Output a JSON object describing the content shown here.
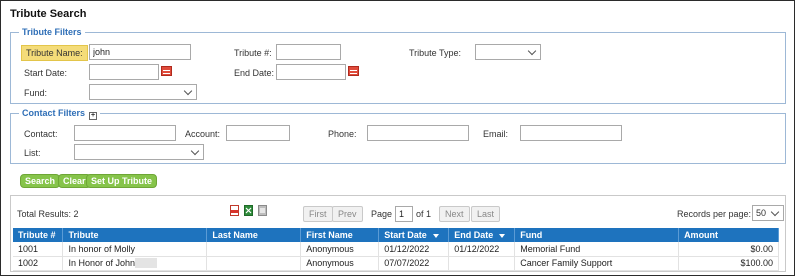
{
  "title": "Tribute Search",
  "tribute_filters": {
    "legend": "Tribute Filters",
    "name_label": "Tribute Name:",
    "name_value": "john",
    "number_label": "Tribute #:",
    "number_value": "",
    "type_label": "Tribute Type:",
    "type_value": "",
    "start_label": "Start Date:",
    "start_value": "",
    "end_label": "End Date:",
    "end_value": "",
    "fund_label": "Fund:",
    "fund_value": ""
  },
  "contact_filters": {
    "legend": "Contact Filters",
    "toggle": "+",
    "contact_label": "Contact:",
    "account_label": "Account:",
    "phone_label": "Phone:",
    "email_label": "Email:",
    "list_label": "List:"
  },
  "actions": {
    "search": "Search",
    "clear": "Clear",
    "setup": "Set Up Tribute"
  },
  "results": {
    "total_label": "Total Results: 2",
    "pager": {
      "first": "First",
      "prev": "Prev",
      "page_label": "Page",
      "page_value": "1",
      "of_label": "of 1",
      "next": "Next",
      "last": "Last"
    },
    "records_label": "Records per page:",
    "records_value": "50",
    "export_icons": [
      "pdf-icon",
      "excel-icon",
      "print-icon"
    ]
  },
  "table": {
    "headers": [
      "Tribute #",
      "Tribute",
      "Last Name",
      "First Name",
      "Start Date",
      "End Date",
      "Fund",
      "Amount"
    ],
    "rows": [
      [
        "1001",
        "In honor of Molly",
        "",
        "Anonymous",
        "01/12/2022",
        "01/12/2022",
        "Memorial Fund",
        "$0.00"
      ],
      [
        "1002",
        "In Honor of John",
        "",
        "Anonymous",
        "07/07/2022",
        "",
        "Cancer Family Support",
        "$100.00"
      ]
    ]
  },
  "colors": {
    "header_blue": "#1e73be",
    "legend_blue": "#2f6fb7",
    "button_green": "#86c44a",
    "highlight": "#f4dc79"
  }
}
